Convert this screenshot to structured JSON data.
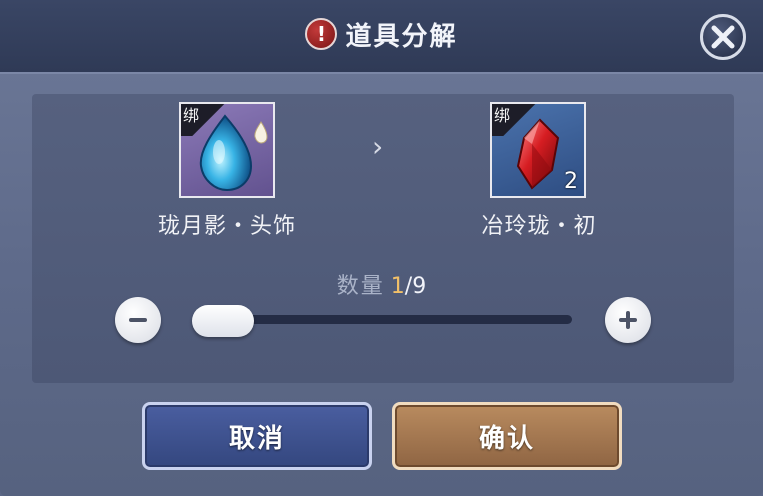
{
  "title": "道具分解",
  "colors": {
    "accent_quantity": "#f2c068",
    "cancel_button": "#3f5390",
    "confirm_button": "#a87a52",
    "source_item_bg": "#7a69a8",
    "result_item_bg": "#3d609a"
  },
  "source_item": {
    "bind_label": "绑",
    "name": "珑月影・头饰",
    "icon": "blue-teardrop-gem-icon"
  },
  "result_item": {
    "bind_label": "绑",
    "name": "冶玲珑・初",
    "count": "2",
    "icon": "red-crystal-icon"
  },
  "arrow_icon": "chevron-right-icon",
  "quantity": {
    "label": "数量",
    "current": "1",
    "total": "/9",
    "slider_fraction": 0.0
  },
  "buttons": {
    "cancel": "取消",
    "confirm": "确认"
  }
}
